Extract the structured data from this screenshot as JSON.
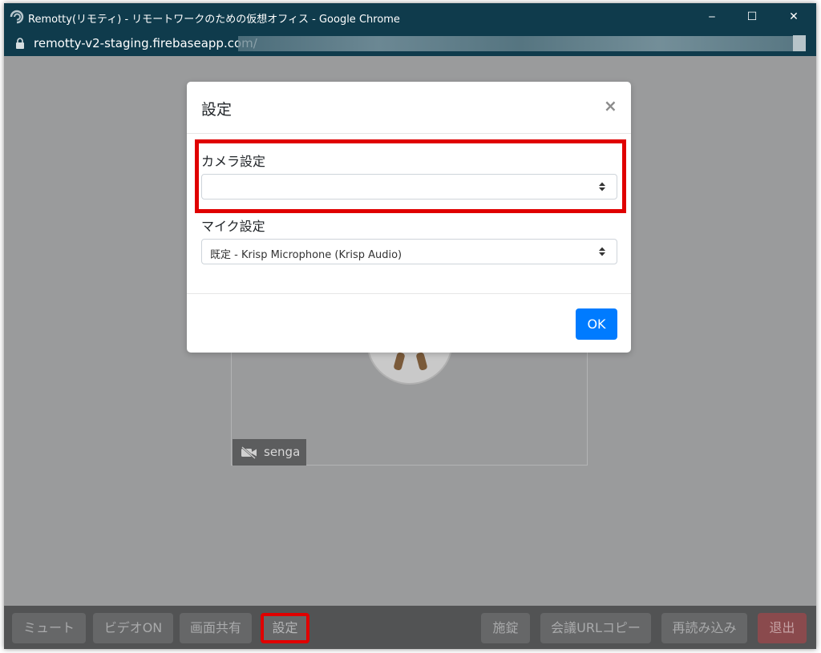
{
  "window": {
    "title": "Remotty(リモティ) - リモートワークのための仮想オフィス - Google Chrome",
    "url": "remotty-v2-staging.firebaseapp.com/",
    "controls": {
      "minimize": "‒",
      "maximize": "☐",
      "close": "✕"
    }
  },
  "video_tile": {
    "name": "senga",
    "status_icon": "video-off-icon"
  },
  "modal": {
    "title": "設定",
    "close": "×",
    "camera": {
      "label": "カメラ設定",
      "value": ""
    },
    "mic": {
      "label": "マイク設定",
      "value": "既定 - Krisp Microphone (Krisp Audio)"
    },
    "ok_label": "OK"
  },
  "toolbar": {
    "mute": "ミュート",
    "video": "ビデオON",
    "screen_share": "画面共有",
    "settings": "設定",
    "lock": "施錠",
    "copy_url": "会議URLコピー",
    "reload": "再読み込み",
    "exit": "退出"
  },
  "colors": {
    "titlebar": "#0f3b4c",
    "primary": "#007bff",
    "highlight": "#e00000",
    "exit": "#8a4a4d"
  }
}
